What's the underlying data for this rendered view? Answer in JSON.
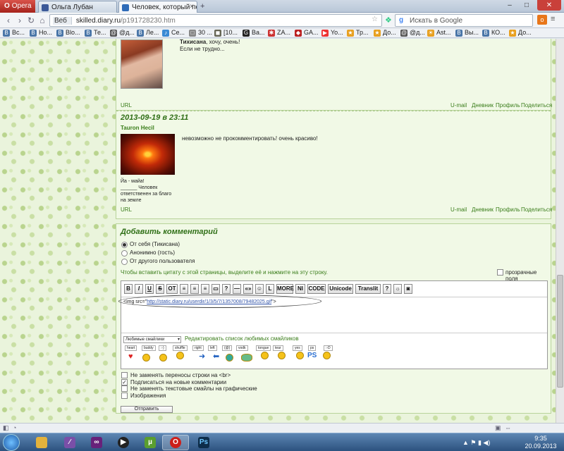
{
  "browser": {
    "menu_label": "Opera",
    "tabs": [
      {
        "label": "Ольга Лубан",
        "favicon": "#3b5998"
      },
      {
        "label": "Человек, который под...",
        "favicon": "#2e6bb8"
      }
    ],
    "nav": {
      "back": "‹",
      "forward": "›",
      "reload": "↻",
      "home": "⌂"
    },
    "address": {
      "indicator": "Веб",
      "host": "skilled.diary.ru",
      "path": "/p191728230.htm"
    },
    "search": {
      "placeholder": "Искать в Google"
    },
    "win": {
      "min": "–",
      "max": "□",
      "close": "✕"
    }
  },
  "bookmarks": [
    {
      "label": "Вс...",
      "color": "#4a76a8",
      "glyph": "B"
    },
    {
      "label": "Но...",
      "color": "#4a76a8",
      "glyph": "B"
    },
    {
      "label": "Blo...",
      "color": "#4a76a8",
      "glyph": "B"
    },
    {
      "label": "Те...",
      "color": "#4a76a8",
      "glyph": "B"
    },
    {
      "label": "@д...",
      "color": "#555",
      "glyph": "@"
    },
    {
      "label": "Ле...",
      "color": "#4a76a8",
      "glyph": "B"
    },
    {
      "label": "Се...",
      "color": "#3a8ad4",
      "glyph": "♪"
    },
    {
      "label": "30 ...",
      "color": "#888",
      "glyph": "□"
    },
    {
      "label": "[10...",
      "color": "#665",
      "glyph": "◼"
    },
    {
      "label": "Ba...",
      "color": "#222",
      "glyph": "G"
    },
    {
      "label": "ZA...",
      "color": "#c33",
      "glyph": "✱"
    },
    {
      "label": "GA...",
      "color": "#b22",
      "glyph": "◆"
    },
    {
      "label": "Yo...",
      "color": "#e33",
      "glyph": "▶"
    },
    {
      "label": "Тр...",
      "color": "#e8a020",
      "glyph": "★"
    },
    {
      "label": "До...",
      "color": "#e8a020",
      "glyph": "★"
    },
    {
      "label": "@д...",
      "color": "#555",
      "glyph": "@"
    },
    {
      "label": "Ast...",
      "color": "#e8a020",
      "glyph": "☀"
    },
    {
      "label": "Вы...",
      "color": "#4a76a8",
      "glyph": "B"
    },
    {
      "label": "КО...",
      "color": "#4a76a8",
      "glyph": "B"
    },
    {
      "label": "До...",
      "color": "#e8a020",
      "glyph": "★"
    }
  ],
  "comment1": {
    "author": "Тихисана",
    "text_after": ", хочу, очень!",
    "line2": "Если не трудно...",
    "url": "URL",
    "links": [
      "U-mail",
      "Дневник",
      "Профиль",
      "Поделиться"
    ]
  },
  "comment2": {
    "date": "2013-09-19 в 23:11",
    "author": "Tauron Hecil",
    "text": "невозможно не прокомментировать! очень красиво!",
    "signature": [
      "Йа - майа!",
      "______ Человек",
      "ответственен за благо",
      "на земле"
    ],
    "url": "URL",
    "links": [
      "U-mail",
      "Дневник",
      "Профиль",
      "Поделиться"
    ]
  },
  "form": {
    "title": "Добавить комментарий",
    "options": [
      "От себя (Тикисана)",
      "Анонимно (гость)",
      "От другого пользователя"
    ],
    "quote_hint": "Чтобы вставить цитату с этой страницы, выделите её и нажмите на эту строку.",
    "transparent_label": "прозрачные поля",
    "toolbar": [
      "B",
      "I",
      "U",
      "S",
      "OT",
      "≡",
      "≡",
      "≡",
      "▭",
      "?",
      "—",
      "«»",
      "☺",
      "L",
      "MORE",
      "NI",
      "CODE",
      "Unicode",
      "Translit",
      "?",
      "☼",
      "◙"
    ],
    "textarea_prefix": "<img src=\"",
    "textarea_url": "http://static.diary.ru/userdir/1/3/5/7/1357008/79482025.gif",
    "textarea_suffix": "\">",
    "smiles_select": "Любимые смайлики",
    "smiles_edit": "Редактировать список любимых смайликов",
    "smile_codes": [
      "heart",
      "buddy",
      ":-)",
      "shuffle",
      "right",
      "left",
      "(@)",
      "vodk",
      "tongue",
      "tear",
      "yes",
      "ps",
      ":-D"
    ],
    "checks": [
      {
        "label": "Не заменять переносы строки на <br>",
        "checked": false
      },
      {
        "label": "Подписаться на новые комментарии",
        "checked": true
      },
      {
        "label": "Не заменять текстовые смайлы на графические",
        "checked": false
      },
      {
        "label": "Изображения",
        "checked": false
      }
    ],
    "submit": "Отправить"
  },
  "clock": {
    "time": "9:35",
    "date": "20.09.2013"
  }
}
